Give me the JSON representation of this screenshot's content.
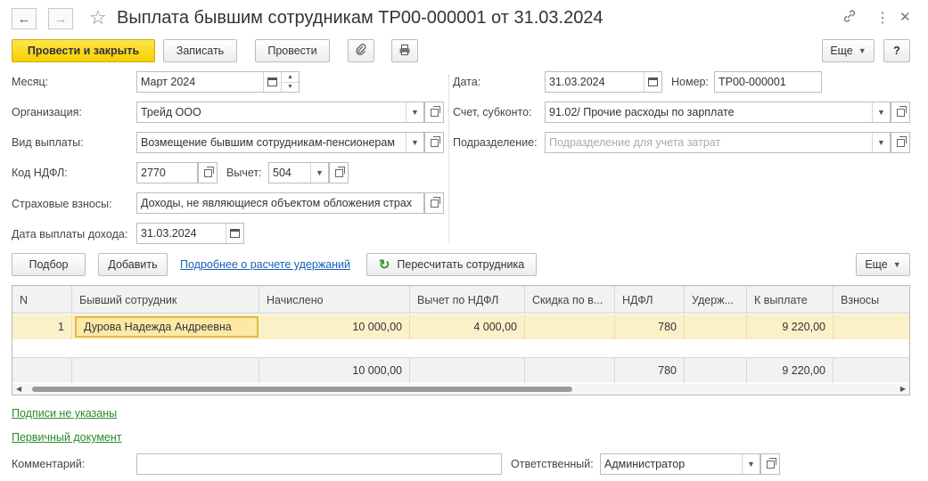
{
  "window": {
    "title": "Выплата бывшим сотрудникам ТР00-000001 от 31.03.2024",
    "icons": [
      "back-arrow-icon",
      "forward-arrow-icon",
      "star-icon",
      "link-icon",
      "more-icon",
      "close-icon"
    ]
  },
  "toolbar": {
    "post_close": "Провести и закрыть",
    "save": "Записать",
    "post": "Провести",
    "more": "Еще",
    "help": "?"
  },
  "form": {
    "month_label": "Месяц:",
    "month_value": "Март 2024",
    "org_label": "Организация:",
    "org_value": "Трейд ООО",
    "payment_type_label": "Вид выплаты:",
    "payment_type_value": "Возмещение бывшим сотрудникам-пенсионерам",
    "ndfl_code_label": "Код НДФЛ:",
    "ndfl_code_value": "2770",
    "deduction_label": "Вычет:",
    "deduction_value": "504",
    "insurance_label": "Страховые взносы:",
    "insurance_value": "Доходы, не являющиеся объектом обложения страх",
    "income_date_label": "Дата выплаты дохода:",
    "income_date_value": "31.03.2024",
    "date_label": "Дата:",
    "date_value": "31.03.2024",
    "number_label": "Номер:",
    "number_value": "ТР00-000001",
    "account_label": "Счет, субконто:",
    "account_value": "91.02/ Прочие расходы по зарплате",
    "department_label": "Подразделение:",
    "department_placeholder": "Подразделение для учета затрат"
  },
  "table_toolbar": {
    "select": "Подбор",
    "add": "Добавить",
    "details_link": "Подробнее о расчете удержаний",
    "recalc": "Пересчитать сотрудника",
    "more": "Еще"
  },
  "table": {
    "columns": [
      "N",
      "Бывший сотрудник",
      "Начислено",
      "Вычет по НДФЛ",
      "Скидка по в...",
      "НДФЛ",
      "Удерж...",
      "К выплате",
      "Взносы"
    ],
    "rows": [
      {
        "n": "1",
        "employee": "Дурова Надежда Андреевна",
        "accrued": "10 000,00",
        "deduction": "4 000,00",
        "discount": "",
        "ndfl": "780",
        "withheld": "",
        "to_pay": "9 220,00",
        "contrib": ""
      }
    ],
    "totals": {
      "accrued": "10 000,00",
      "ndfl": "780",
      "to_pay": "9 220,00"
    }
  },
  "footer": {
    "signatures_link": "Подписи не указаны",
    "primary_doc_link": "Первичный документ",
    "comment_label": "Комментарий:",
    "comment_value": "",
    "responsible_label": "Ответственный:",
    "responsible_value": "Администратор"
  }
}
